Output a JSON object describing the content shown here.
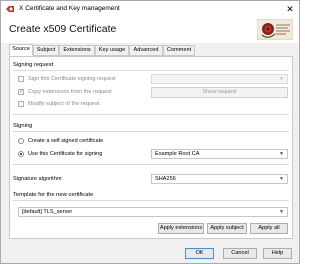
{
  "window": {
    "title": "X Certificate and Key management",
    "close_glyph": "✕"
  },
  "header": {
    "heading": "Create x509 Certificate",
    "logo_icon": "rose-logo-icon"
  },
  "tabs": [
    {
      "label": "Source",
      "active": true
    },
    {
      "label": "Subject",
      "active": false
    },
    {
      "label": "Extensions",
      "active": false
    },
    {
      "label": "Key usage",
      "active": false
    },
    {
      "label": "Advanced",
      "active": false
    },
    {
      "label": "Comment",
      "active": false
    }
  ],
  "signing_request": {
    "title": "Signing request",
    "sign_label": "Sign this Certificate signing request",
    "copy_ext_label": "Copy extensions from the request",
    "modify_subject_label": "Modify subject of the request",
    "request_combo_value": "",
    "show_request_button": "Show request"
  },
  "signing": {
    "title": "Signing",
    "self_signed_label": "Create a self signed certificate",
    "use_cert_label": "Use this Certificate for signing",
    "ca_value": "Example Root CA",
    "selected": "use_cert"
  },
  "algorithm": {
    "label": "Signature algorithm",
    "value": "SHA256"
  },
  "template": {
    "title": "Template for the new certificate",
    "value": "[default] TLS_server",
    "apply_extensions": "Apply extensions",
    "apply_subject": "Apply subject",
    "apply_all": "Apply all"
  },
  "footer": {
    "ok": "OK",
    "cancel": "Cancel",
    "help": "Help"
  },
  "colors": {
    "accent": "#4a90d9",
    "panel_border": "#c9c9c9",
    "window_bg": "#f0f0f0"
  }
}
